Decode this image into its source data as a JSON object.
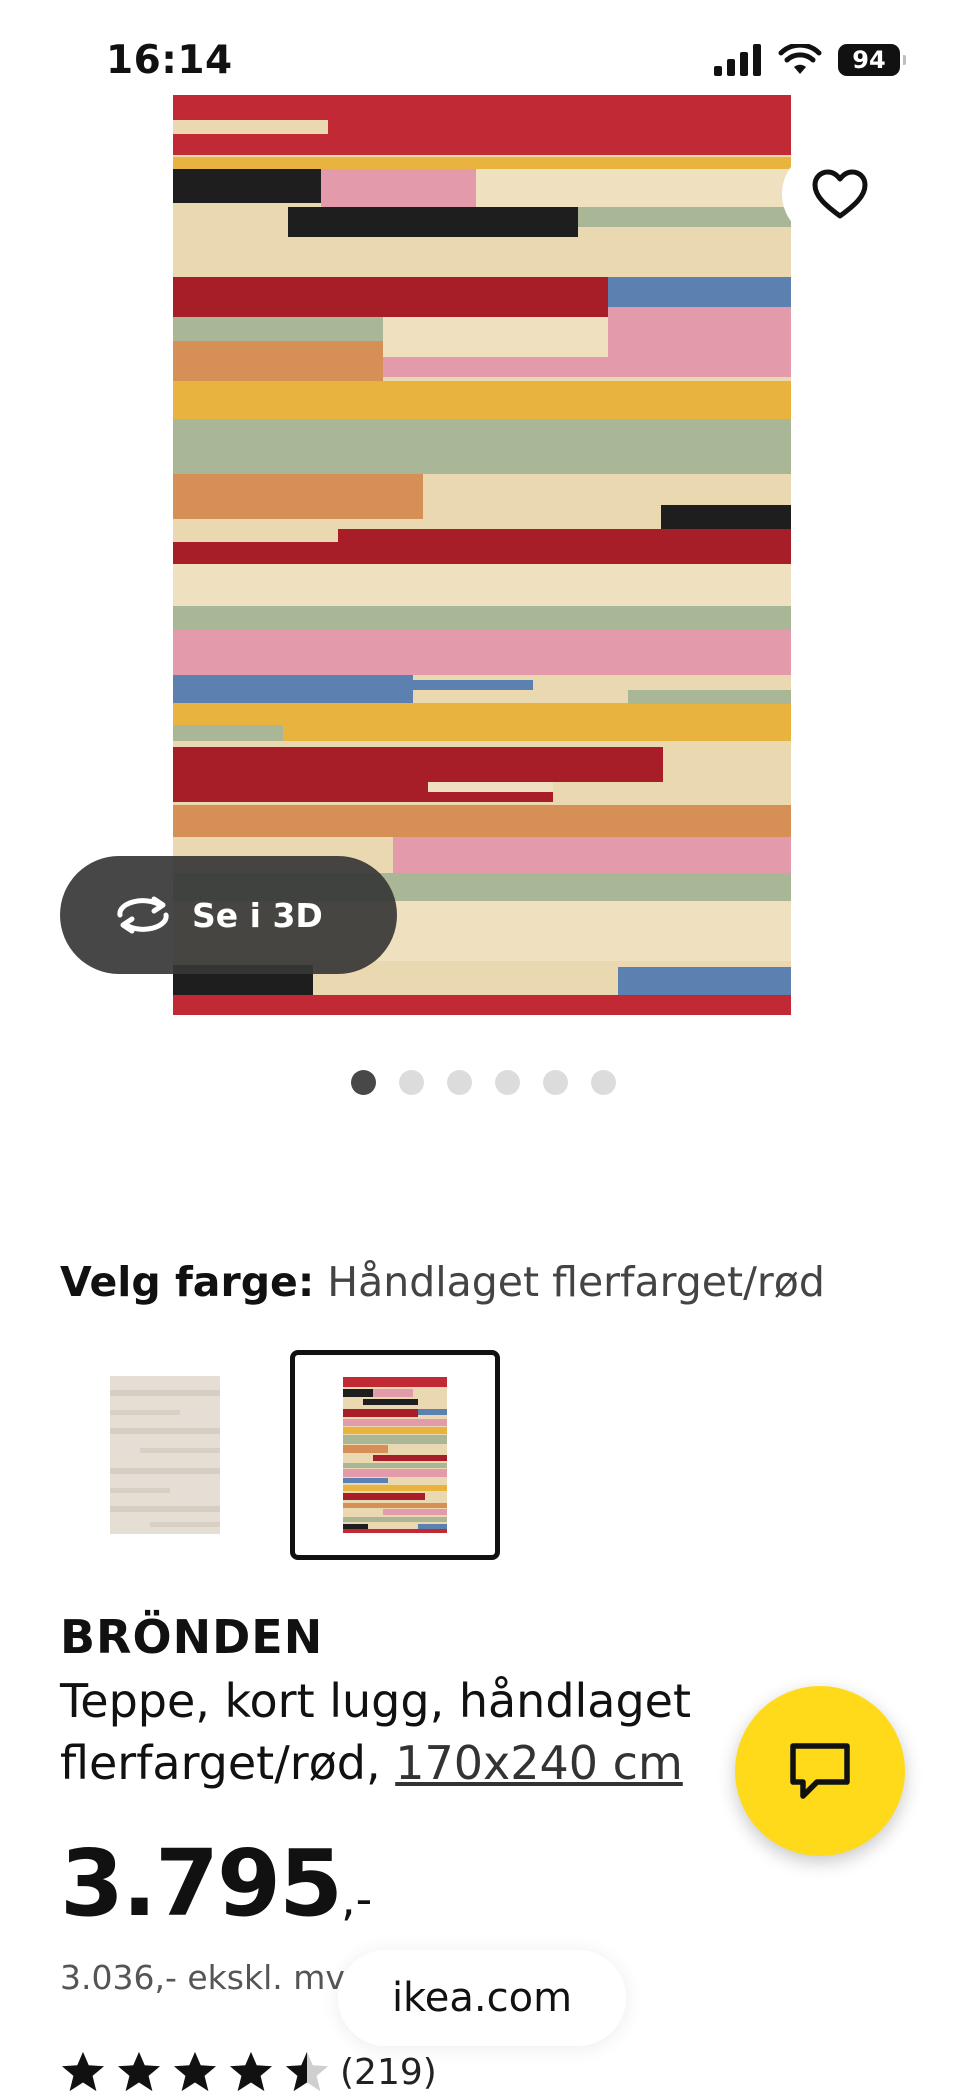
{
  "status_bar": {
    "time": "16:14",
    "battery": "94"
  },
  "hero": {
    "view_3d_label": "Se i 3D",
    "image_count": 6,
    "active_image": 1
  },
  "color_selector": {
    "label": "Velg farge:",
    "value": "Håndlaget flerfarget/rød",
    "selected_index": 1,
    "options": [
      "natural-stripes",
      "multicolour-red"
    ]
  },
  "product": {
    "name": "BRÖNDEN",
    "description": "Teppe, kort lugg, håndlaget flerfarget/rød,",
    "size": "170x240 cm",
    "price": "3.795",
    "price_suffix": ",-",
    "price_ex_vat": "3.036,- ekskl. mv",
    "rating_count": "(219)",
    "rating": 4.5
  },
  "browser": {
    "url": "ikea.com"
  },
  "colors": {
    "accent": "#FFDA1A",
    "overlay": "#373737",
    "dot_active": "#484848",
    "dot_inactive": "#dcdcdc"
  },
  "icons": [
    "signal-icon",
    "wifi-icon",
    "battery-icon",
    "heart-icon",
    "rotate-3d-icon",
    "chat-icon",
    "star-icon"
  ]
}
